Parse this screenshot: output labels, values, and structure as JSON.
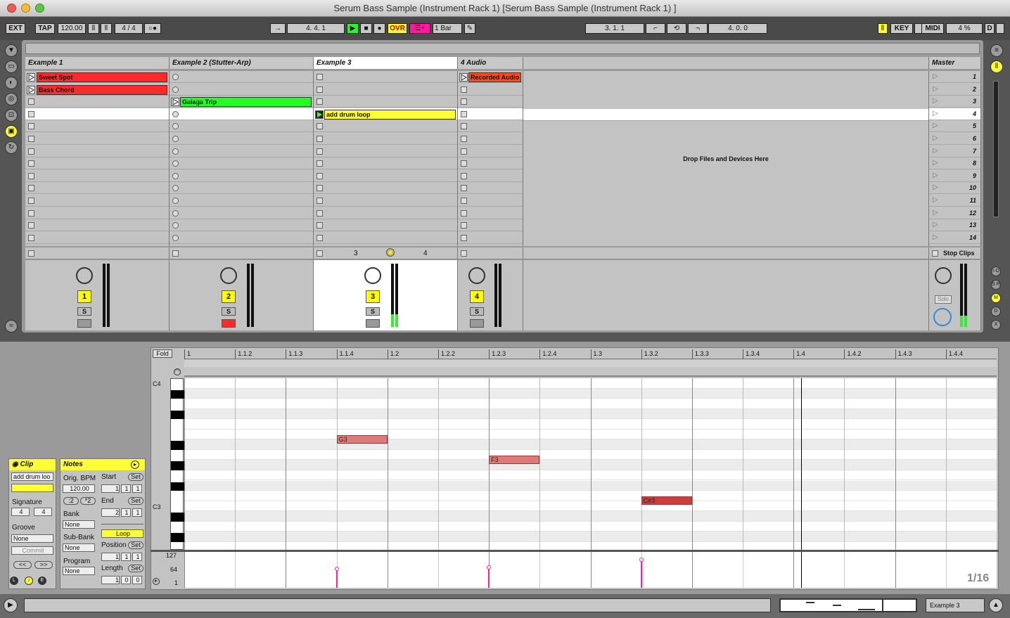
{
  "window": {
    "title": "Serum Bass Sample (Instrument Rack 1)   [Serum Bass Sample (Instrument Rack 1) ]"
  },
  "control_bar": {
    "ext": "EXT",
    "tap": "TAP",
    "tempo": "120.00",
    "signature": "4 / 4",
    "arrangement_pos": "4.   4.   1",
    "ovr": "OVR",
    "quantize": "1 Bar",
    "loop_start": "3.   1.   1",
    "loop_length": "4.   0.   0",
    "key": "KEY",
    "midi": "MIDI",
    "cpu": "4 %",
    "d": "D"
  },
  "tracks": [
    {
      "name": "Example 1",
      "number": "1"
    },
    {
      "name": "Example 2 (Stutter-Arp)",
      "number": "2"
    },
    {
      "name": "Example 3",
      "number": "3"
    },
    {
      "name": "4 Audio",
      "number": "4"
    }
  ],
  "master": {
    "name": "Master",
    "scenes": [
      "1",
      "2",
      "3",
      "4",
      "5",
      "6",
      "7",
      "8",
      "9",
      "10",
      "11",
      "12",
      "13",
      "14"
    ],
    "stop_clips": "Stop Clips",
    "solo": "Solo"
  },
  "clips": {
    "sweet_spot": "Sweet Spot",
    "bass_chord": "Bass Chord",
    "galaga_trip": "Galaga Trip",
    "add_drum_loop": "add drum loop",
    "recorded_audio": "Recorded Audio"
  },
  "drop_hint": "Drop Files and Devices Here",
  "crossfade": {
    "left": "3",
    "right": "4"
  },
  "track_buttons": {
    "solo": "S"
  },
  "clip_panel": {
    "title": "Clip",
    "name_value": "add drum loo",
    "signature_label": "Signature",
    "sig_num": "4",
    "sig_den": "4",
    "groove_label": "Groove",
    "groove_value": "None",
    "commit": "Commit",
    "prev": "<<",
    "next": ">>"
  },
  "notes_panel": {
    "title": "Notes",
    "orig_bpm_label": "Orig. BPM",
    "orig_bpm": "120.00",
    "half": ":2",
    "double": "*2",
    "bank_label": "Bank",
    "bank": "None",
    "subbank_label": "Sub-Bank",
    "subbank": "None",
    "program_label": "Program",
    "program": "None",
    "start_label": "Start",
    "end_label": "End",
    "loop": "Loop",
    "position_label": "Position",
    "length_label": "Length",
    "set": "Set",
    "start": [
      "1",
      "1",
      "1"
    ],
    "end": [
      "2",
      "1",
      "1"
    ],
    "position": [
      "1",
      "1",
      "1"
    ],
    "length": [
      "1",
      "0",
      "0"
    ]
  },
  "piano_roll": {
    "fold": "Fold",
    "ruler": [
      "1",
      "1.1.2",
      "1.1.3",
      "1.1.4",
      "1.2",
      "1.2.2",
      "1.2.3",
      "1.2.4",
      "1.3",
      "1.3.2",
      "1.3.3",
      "1.3.4",
      "1.4",
      "1.4.2",
      "1.4.3",
      "1.4.4"
    ],
    "keys": {
      "c4": "C4",
      "c3": "C3"
    },
    "notes": [
      {
        "name": "G3",
        "start_beat": 1.5,
        "length_beats": 0.5,
        "color": "#e07a7a"
      },
      {
        "name": "F3",
        "start_beat": 3.0,
        "length_beats": 0.5,
        "color": "#e07a7a"
      },
      {
        "name": "C#3",
        "start_beat": 4.5,
        "length_beats": 0.5,
        "color": "#d03c3c"
      }
    ],
    "velocity_labels": [
      "127",
      "64",
      "1"
    ],
    "grid": "1/16"
  },
  "status": {
    "track": "Example 3"
  },
  "colors": {
    "red": "#ff2a2a",
    "green": "#22ff22",
    "yellow": "#ffff33",
    "orange": "#ff4a1a",
    "magenta": "#ff1aa0"
  }
}
